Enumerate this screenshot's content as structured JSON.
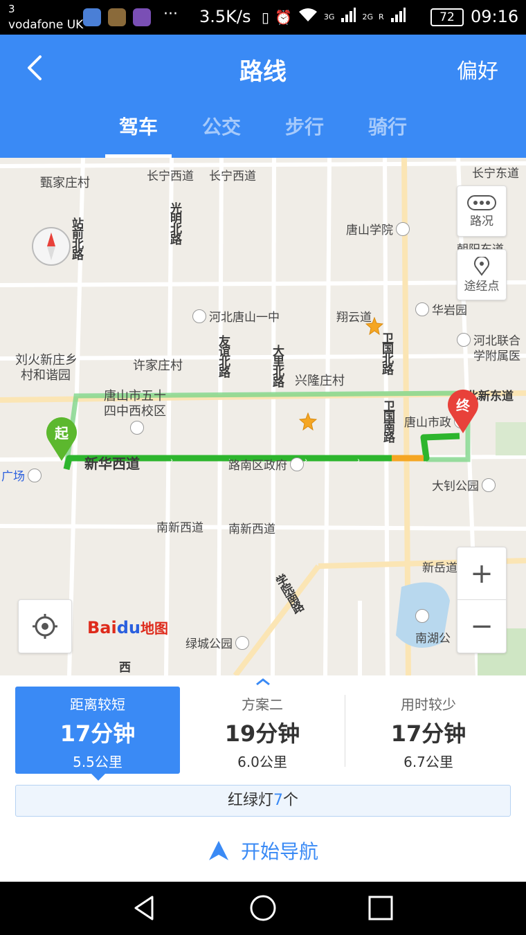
{
  "status_bar": {
    "carrier_number": "3",
    "carrier": "vodafone UK",
    "more": "···",
    "speed": "3.5K/s",
    "network_3g": "3G",
    "network_2g": "2G",
    "roaming": "R",
    "battery": "72",
    "time": "09:16"
  },
  "header": {
    "title": "路线",
    "preference": "偏好",
    "tabs": [
      {
        "label": "驾车"
      },
      {
        "label": "公交"
      },
      {
        "label": "步行"
      },
      {
        "label": "骑行"
      }
    ]
  },
  "map": {
    "traffic_button": "路况",
    "waypoint_button": "途经点",
    "zoom_in": "+",
    "zoom_out": "−",
    "start_pin": "起",
    "end_pin": "终",
    "logo": {
      "bai": "Bai",
      "du": "du",
      "map": "地图"
    },
    "labels": {
      "road_changning_w1": "长宁西道",
      "road_changning_w2": "长宁西道",
      "road_changning_e": "长宁东道",
      "zhenjia": "甄家庄村",
      "guangming": "光明北路",
      "zhanqian": "站前北路",
      "tangshan_college": "唐山学院",
      "chaoyang_e": "朝阳东道",
      "hebei_no1": "河北唐山一中",
      "xiangyun": "翔云道",
      "huayan": "华岩园",
      "liuhuo": "刘火新庄乡",
      "cunhexie": "村和谐园",
      "xujia": "许家庄村",
      "youyi": "友谊北路",
      "dali": "大里北路",
      "xinglong": "兴隆庄村",
      "weiguo_n": "卫国北路",
      "hebei_united": "河北联合",
      "xuefu": "学附属医",
      "bei_xindong": "北新东道",
      "school54_1": "唐山市五十",
      "school54_2": "四中西校区",
      "weiguo_s": "卫国南路",
      "city_gov": "唐山市政",
      "xinhua": "新华西道",
      "lunan_gov": "路南区政府",
      "square": "广场",
      "dazhao": "大钊公园",
      "nanxin_w1": "南新西道",
      "nanxin_w2": "南新西道",
      "xinyue": "新岳道",
      "xueyuan": "学院南路",
      "lvcheng": "绿城公园",
      "nanhu": "南湖公",
      "xi": "西"
    }
  },
  "routes": [
    {
      "name": "距离较短",
      "time": "17分钟",
      "distance": "5.5公里",
      "active": true
    },
    {
      "name": "方案二",
      "time": "19分钟",
      "distance": "6.0公里",
      "active": false
    },
    {
      "name": "用时较少",
      "time": "17分钟",
      "distance": "6.7公里",
      "active": false
    }
  ],
  "traffic_lights": {
    "prefix": "红绿灯",
    "count": "7",
    "suffix": "个"
  },
  "navigate": "开始导航",
  "colors": {
    "accent": "#3a8af5",
    "route_green": "#2db52d",
    "route_orange": "#f5a623",
    "pin_start": "#5cb82e",
    "pin_end": "#e8413a"
  }
}
